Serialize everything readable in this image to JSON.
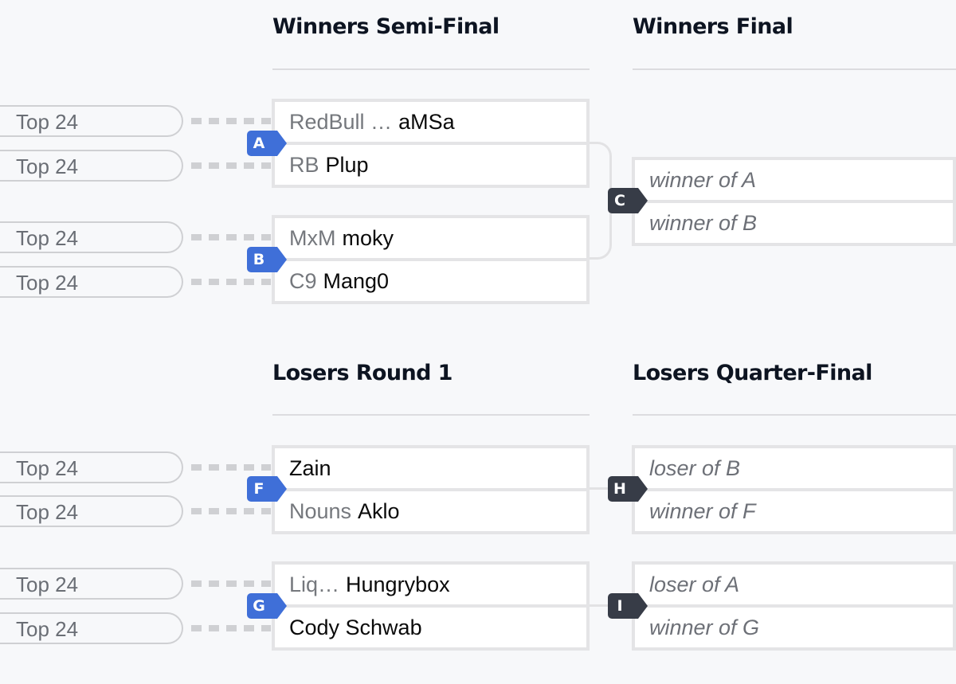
{
  "rounds": {
    "winners_semi": {
      "title": "Winners Semi-Final"
    },
    "winners_final": {
      "title": "Winners Final"
    },
    "losers_r1": {
      "title": "Losers Round 1"
    },
    "losers_qf": {
      "title": "Losers Quarter-Final"
    }
  },
  "seed_label": "Top 24",
  "matches": {
    "A": {
      "id": "A",
      "slots": [
        {
          "prefix": "RedBull …",
          "name": "aMSa"
        },
        {
          "prefix": "RB",
          "name": "Plup"
        }
      ]
    },
    "B": {
      "id": "B",
      "slots": [
        {
          "prefix": "MxM",
          "name": "moky"
        },
        {
          "prefix": "C9",
          "name": "Mang0"
        }
      ]
    },
    "C": {
      "id": "C",
      "slots": [
        {
          "placeholder": "winner of A"
        },
        {
          "placeholder": "winner of B"
        }
      ]
    },
    "F": {
      "id": "F",
      "slots": [
        {
          "prefix": "",
          "name": "Zain"
        },
        {
          "prefix": "Nouns",
          "name": "Aklo"
        }
      ]
    },
    "G": {
      "id": "G",
      "slots": [
        {
          "prefix": "Liq…",
          "name": "Hungrybox"
        },
        {
          "prefix": "",
          "name": "Cody Schwab"
        }
      ]
    },
    "H": {
      "id": "H",
      "slots": [
        {
          "placeholder": "loser of B"
        },
        {
          "placeholder": "winner of F"
        }
      ]
    },
    "I": {
      "id": "I",
      "slots": [
        {
          "placeholder": "loser of A"
        },
        {
          "placeholder": "winner of G"
        }
      ]
    }
  },
  "colors": {
    "winners_badge": "#3f6fd8",
    "pending_badge": "#373c47",
    "background": "#f7f8fa"
  }
}
